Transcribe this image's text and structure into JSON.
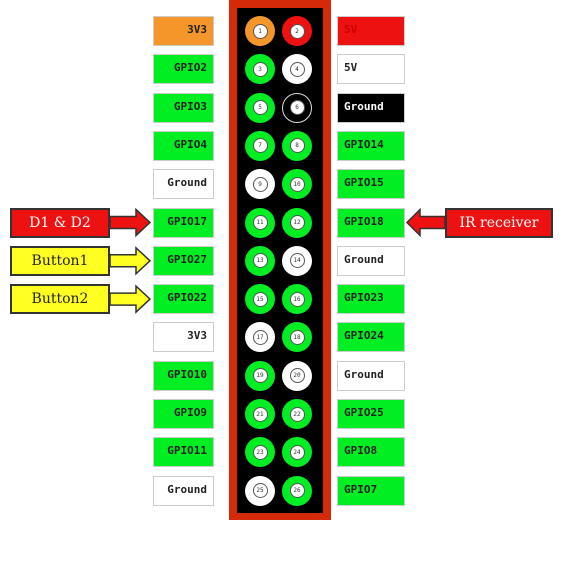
{
  "colors": {
    "green": "#00ee22",
    "white": "#ffffff",
    "orange": "#f5962a",
    "red": "#ee1111",
    "black": "#000000",
    "yellow": "#ffff22"
  },
  "rows": [
    {
      "left": {
        "label": "3V3",
        "color": "orange"
      },
      "right": {
        "label": "5V",
        "color": "red"
      },
      "pins": [
        {
          "n": "1",
          "color": "orange"
        },
        {
          "n": "2",
          "color": "red"
        }
      ]
    },
    {
      "left": {
        "label": "GPIO2",
        "color": "green"
      },
      "right": {
        "label": "5V",
        "color": "white"
      },
      "pins": [
        {
          "n": "3",
          "color": "green"
        },
        {
          "n": "4",
          "color": "white"
        }
      ]
    },
    {
      "left": {
        "label": "GPIO3",
        "color": "green"
      },
      "right": {
        "label": "Ground",
        "color": "black"
      },
      "pins": [
        {
          "n": "5",
          "color": "green"
        },
        {
          "n": "6",
          "color": "black"
        }
      ]
    },
    {
      "left": {
        "label": "GPIO4",
        "color": "green"
      },
      "right": {
        "label": "GPIO14",
        "color": "green"
      },
      "pins": [
        {
          "n": "7",
          "color": "green"
        },
        {
          "n": "8",
          "color": "green"
        }
      ]
    },
    {
      "left": {
        "label": "Ground",
        "color": "white"
      },
      "right": {
        "label": "GPIO15",
        "color": "green"
      },
      "pins": [
        {
          "n": "9",
          "color": "white"
        },
        {
          "n": "10",
          "color": "green"
        }
      ]
    },
    {
      "left": {
        "label": "GPIO17",
        "color": "green"
      },
      "right": {
        "label": "GPIO18",
        "color": "green"
      },
      "pins": [
        {
          "n": "11",
          "color": "green"
        },
        {
          "n": "12",
          "color": "green"
        }
      ]
    },
    {
      "left": {
        "label": "GPIO27",
        "color": "green"
      },
      "right": {
        "label": "Ground",
        "color": "white"
      },
      "pins": [
        {
          "n": "13",
          "color": "green"
        },
        {
          "n": "14",
          "color": "white"
        }
      ]
    },
    {
      "left": {
        "label": "GPIO22",
        "color": "green"
      },
      "right": {
        "label": "GPIO23",
        "color": "green"
      },
      "pins": [
        {
          "n": "15",
          "color": "green"
        },
        {
          "n": "16",
          "color": "green"
        }
      ]
    },
    {
      "left": {
        "label": "3V3",
        "color": "white"
      },
      "right": {
        "label": "GPIO24",
        "color": "green"
      },
      "pins": [
        {
          "n": "17",
          "color": "white"
        },
        {
          "n": "18",
          "color": "green"
        }
      ]
    },
    {
      "left": {
        "label": "GPIO10",
        "color": "green"
      },
      "right": {
        "label": "Ground",
        "color": "white"
      },
      "pins": [
        {
          "n": "19",
          "color": "green"
        },
        {
          "n": "20",
          "color": "white"
        }
      ]
    },
    {
      "left": {
        "label": "GPIO9",
        "color": "green"
      },
      "right": {
        "label": "GPIO25",
        "color": "green"
      },
      "pins": [
        {
          "n": "21",
          "color": "green"
        },
        {
          "n": "22",
          "color": "green"
        }
      ]
    },
    {
      "left": {
        "label": "GPIO11",
        "color": "green"
      },
      "right": {
        "label": "GPIO8",
        "color": "green"
      },
      "pins": [
        {
          "n": "23",
          "color": "green"
        },
        {
          "n": "24",
          "color": "green"
        }
      ]
    },
    {
      "left": {
        "label": "Ground",
        "color": "white"
      },
      "right": {
        "label": "GPIO7",
        "color": "green"
      },
      "pins": [
        {
          "n": "25",
          "color": "white"
        },
        {
          "n": "26",
          "color": "green"
        }
      ]
    }
  ],
  "annotations": [
    {
      "label": "D1 & D2",
      "color": "red",
      "row": 5,
      "side": "left"
    },
    {
      "label": "Button1",
      "color": "yellow",
      "row": 6,
      "side": "left"
    },
    {
      "label": "Button2",
      "color": "yellow",
      "row": 7,
      "side": "left"
    },
    {
      "label": "IR receiver",
      "color": "red",
      "row": 5,
      "side": "right"
    }
  ]
}
